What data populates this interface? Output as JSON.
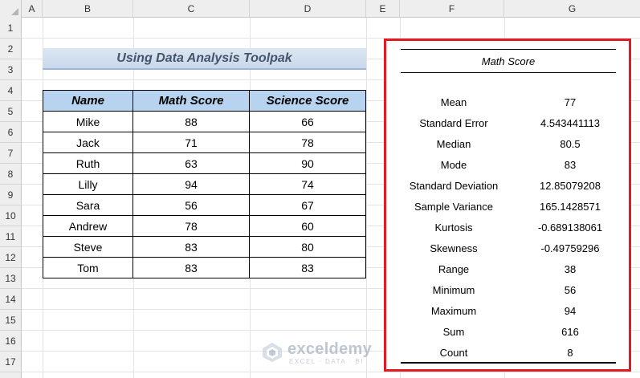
{
  "columns": [
    "A",
    "B",
    "C",
    "D",
    "E",
    "F",
    "G"
  ],
  "rows": [
    "1",
    "2",
    "3",
    "4",
    "5",
    "6",
    "7",
    "8",
    "9",
    "10",
    "11",
    "12",
    "13",
    "14",
    "15",
    "16",
    "17"
  ],
  "title": "Using Data Analysis Toolpak",
  "table": {
    "headers": [
      "Name",
      "Math Score",
      "Science Score"
    ],
    "rows": [
      [
        "Mike",
        "88",
        "66"
      ],
      [
        "Jack",
        "71",
        "78"
      ],
      [
        "Ruth",
        "63",
        "90"
      ],
      [
        "Lilly",
        "94",
        "74"
      ],
      [
        "Sara",
        "56",
        "67"
      ],
      [
        "Andrew",
        "78",
        "60"
      ],
      [
        "Steve",
        "83",
        "80"
      ],
      [
        "Tom",
        "83",
        "83"
      ]
    ]
  },
  "stats": {
    "heading": "Math Score",
    "items": [
      {
        "label": "Mean",
        "value": "77"
      },
      {
        "label": "Standard Error",
        "value": "4.543441113"
      },
      {
        "label": "Median",
        "value": "80.5"
      },
      {
        "label": "Mode",
        "value": "83"
      },
      {
        "label": "Standard Deviation",
        "value": "12.85079208"
      },
      {
        "label": "Sample Variance",
        "value": "165.1428571"
      },
      {
        "label": "Kurtosis",
        "value": "-0.689138061"
      },
      {
        "label": "Skewness",
        "value": "-0.49759296"
      },
      {
        "label": "Range",
        "value": "38"
      },
      {
        "label": "Minimum",
        "value": "56"
      },
      {
        "label": "Maximum",
        "value": "94"
      },
      {
        "label": "Sum",
        "value": "616"
      },
      {
        "label": "Count",
        "value": "8"
      }
    ]
  },
  "highlight_color": "#e01b24",
  "header_fill_color": "#b7d3ef",
  "watermark": {
    "name": "exceldemy",
    "tagline": "EXCEL · DATA · BI",
    "icon": "exceldemy-logo-icon"
  }
}
